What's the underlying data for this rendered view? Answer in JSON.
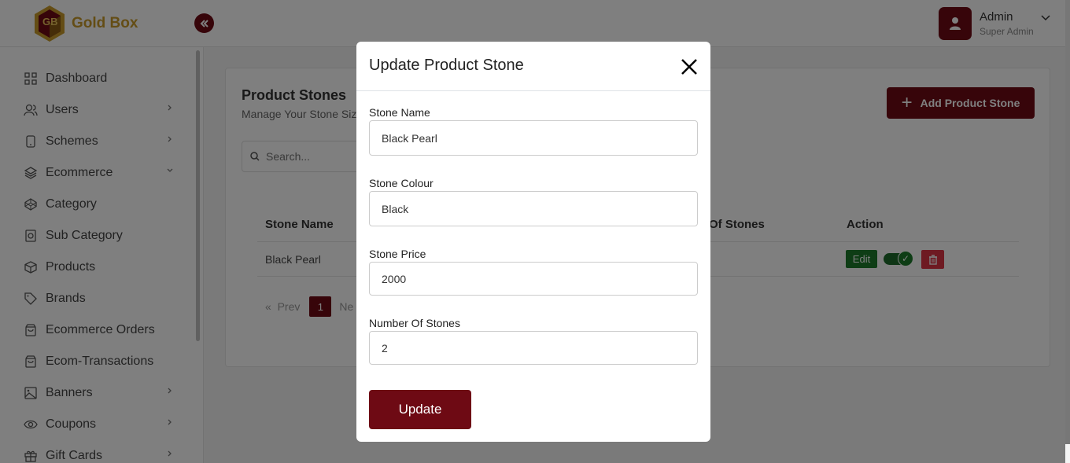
{
  "brand": {
    "name": "Gold Box",
    "logo_letters": "GB"
  },
  "header": {
    "user_name": "Admin",
    "user_role": "Super Admin"
  },
  "sidebar": {
    "items": [
      {
        "label": "Dashboard",
        "icon": "grid-icon",
        "has_chevron": false
      },
      {
        "label": "Users",
        "icon": "users-icon",
        "has_chevron": true
      },
      {
        "label": "Schemes",
        "icon": "phone-icon",
        "has_chevron": true
      },
      {
        "label": "Ecommerce",
        "icon": "layers-icon",
        "has_chevron": true
      },
      {
        "label": "Category",
        "icon": "codepen-icon",
        "has_chevron": false
      },
      {
        "label": "Sub Category",
        "icon": "watch-icon",
        "has_chevron": false
      },
      {
        "label": "Products",
        "icon": "box-icon",
        "has_chevron": false
      },
      {
        "label": "Brands",
        "icon": "tag-icon",
        "has_chevron": false
      },
      {
        "label": "Ecommerce Orders",
        "icon": "shopping-bag-icon",
        "has_chevron": false
      },
      {
        "label": "Ecom-Transactions",
        "icon": "shopping-bag-icon",
        "has_chevron": false
      },
      {
        "label": "Banners",
        "icon": "image-icon",
        "has_chevron": true
      },
      {
        "label": "Coupons",
        "icon": "eye-icon",
        "has_chevron": true
      },
      {
        "label": "Gift Cards",
        "icon": "gift-icon",
        "has_chevron": true
      }
    ]
  },
  "main": {
    "title": "Product Stones",
    "subtitle": "Manage Your Stone Size",
    "add_button": "Add Product Stone",
    "search_placeholder": "Search...",
    "table": {
      "col_stone_name": "Stone Name",
      "col_number_partial": "Of Stones",
      "col_action": "Action",
      "row_stone_name": "Black Pearl",
      "edit_label": "Edit"
    },
    "pagination": {
      "prev": "Prev",
      "current": "1",
      "next_partial": "Ne"
    }
  },
  "modal": {
    "title": "Update Product Stone",
    "fields": {
      "stone_name": {
        "label": "Stone Name",
        "value": "Black Pearl"
      },
      "stone_colour": {
        "label": "Stone Colour",
        "value": "Black"
      },
      "stone_price": {
        "label": "Stone Price",
        "value": "2000"
      },
      "number_of_stones": {
        "label": "Number Of Stones",
        "value": "2"
      }
    },
    "submit_label": "Update"
  },
  "colors": {
    "primary": "#6e0a14",
    "gold": "#c89b2a",
    "success": "#1d7a2b",
    "danger": "#dc3545"
  }
}
